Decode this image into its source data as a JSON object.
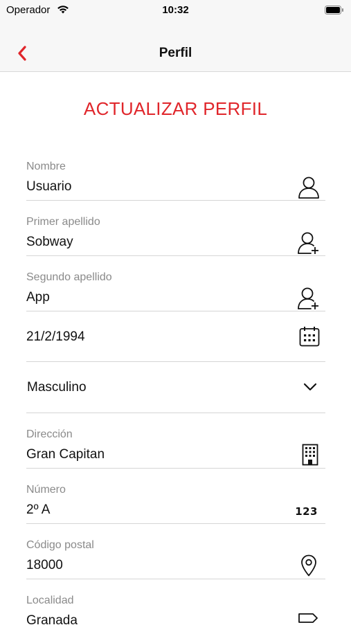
{
  "status": {
    "carrier": "Operador",
    "time": "10:32"
  },
  "nav": {
    "title": "Perfil",
    "back_icon": "chevron-left-icon"
  },
  "heading": "ACTUALIZAR PERFIL",
  "colors": {
    "accent": "#e0262b",
    "label": "#8a8a8a",
    "divider": "#d5d5d5"
  },
  "fields": {
    "nombre": {
      "label": "Nombre",
      "value": "Usuario",
      "icon": "person-icon"
    },
    "primer_apellido": {
      "label": "Primer apellido",
      "value": "Sobway",
      "icon": "person-add-icon"
    },
    "segundo_apellido": {
      "label": "Segundo apellido",
      "value": "App",
      "icon": "person-add-icon"
    },
    "fecha": {
      "value": "21/2/1994",
      "icon": "calendar-icon"
    },
    "sexo": {
      "value": "Masculino",
      "icon": "chevron-down-icon"
    },
    "direccion": {
      "label": "Dirección",
      "value": "Gran Capitan",
      "icon": "building-icon"
    },
    "numero": {
      "label": "Número",
      "value": "2º A",
      "icon": "numbers-icon",
      "icon_text": "123"
    },
    "codigo_postal": {
      "label": "Código postal",
      "value": "18000",
      "icon": "location-pin-icon"
    },
    "localidad": {
      "label": "Localidad",
      "value": "Granada",
      "icon": "signpost-icon"
    }
  }
}
